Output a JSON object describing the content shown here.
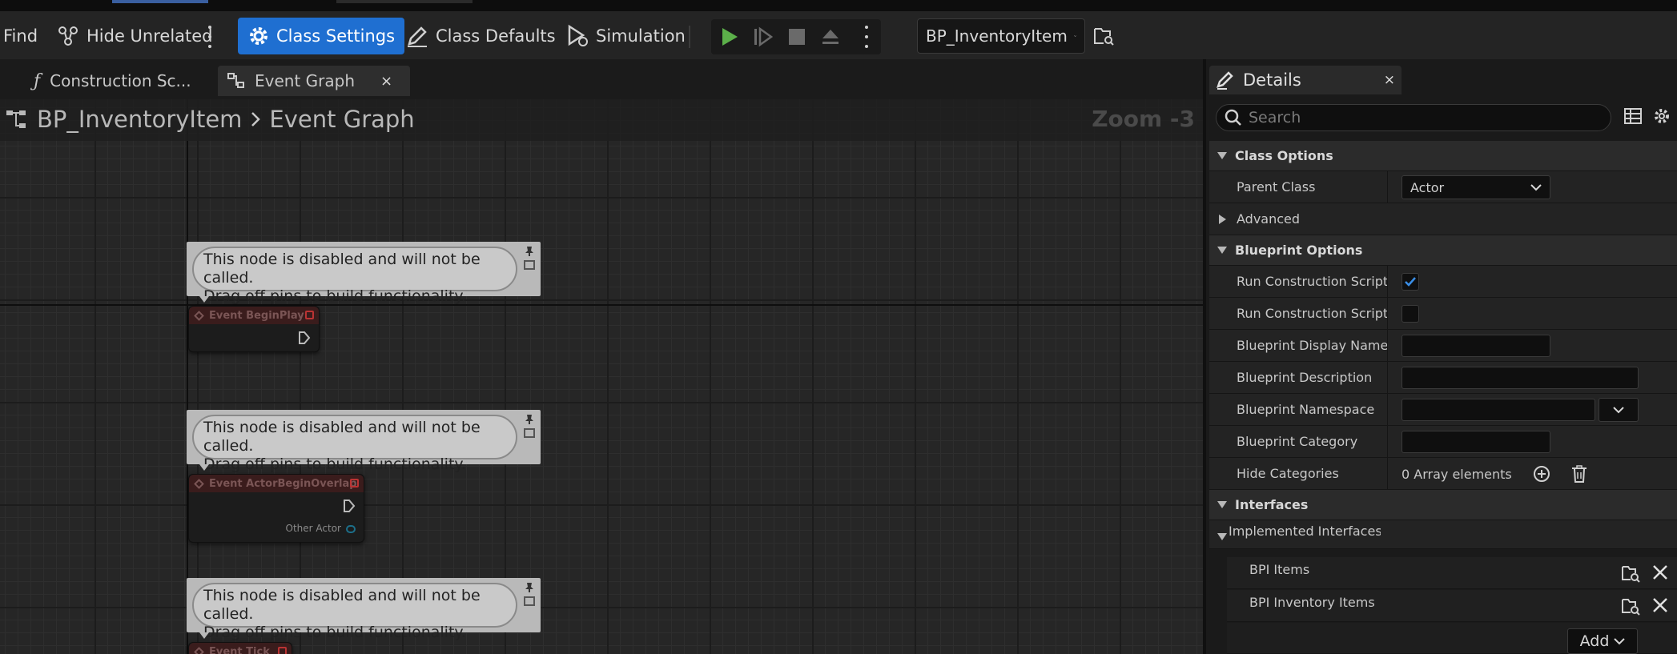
{
  "toolbar": {
    "find_label": "Find",
    "hide_unrelated_label": "Hide Unrelated",
    "class_settings_label": "Class Settings",
    "class_defaults_label": "Class Defaults",
    "simulation_label": "Simulation",
    "blueprint_selector": "BP_InventoryItem"
  },
  "graph_tabs": [
    {
      "label": "Construction Sc..."
    },
    {
      "label": "Event Graph",
      "close": "×"
    }
  ],
  "graph": {
    "breadcrumb_root": "BP_InventoryItem",
    "breadcrumb_current": "Event Graph",
    "zoom": "Zoom -3",
    "comments": [
      {
        "line1": "This node is disabled and will not be called.",
        "line2": "Drag off pins to build functionality."
      },
      {
        "line1": "This node is disabled and will not be called.",
        "line2": "Drag off pins to build functionality."
      },
      {
        "line1": "This node is disabled and will not be called.",
        "line2": "Drag off pins to build functionality."
      }
    ],
    "nodes": [
      {
        "title": "Event BeginPlay"
      },
      {
        "title": "Event ActorBeginOverlap",
        "pin": "Other Actor"
      },
      {
        "title": "Event Tick"
      }
    ]
  },
  "details": {
    "tab_label": "Details",
    "tab_close": "×",
    "search_placeholder": "Search",
    "class_options": {
      "title": "Class Options",
      "parent_class_label": "Parent Class",
      "parent_class_value": "Actor",
      "advanced_label": "Advanced"
    },
    "blueprint_options": {
      "title": "Blueprint Options",
      "run_cs_1_label": "Run Construction Script...",
      "run_cs_1_checked": true,
      "run_cs_2_label": "Run Construction Script...",
      "run_cs_2_checked": false,
      "display_name_label": "Blueprint Display Name",
      "description_label": "Blueprint Description",
      "namespace_label": "Blueprint Namespace",
      "category_label": "Blueprint Category",
      "hide_categories_label": "Hide Categories",
      "hide_categories_value": "0 Array elements"
    },
    "interfaces": {
      "title": "Interfaces",
      "implemented_label": "Implemented Interfaces",
      "items": [
        "BPI Items",
        "BPI Inventory Items"
      ],
      "add_label": "Add"
    }
  }
}
